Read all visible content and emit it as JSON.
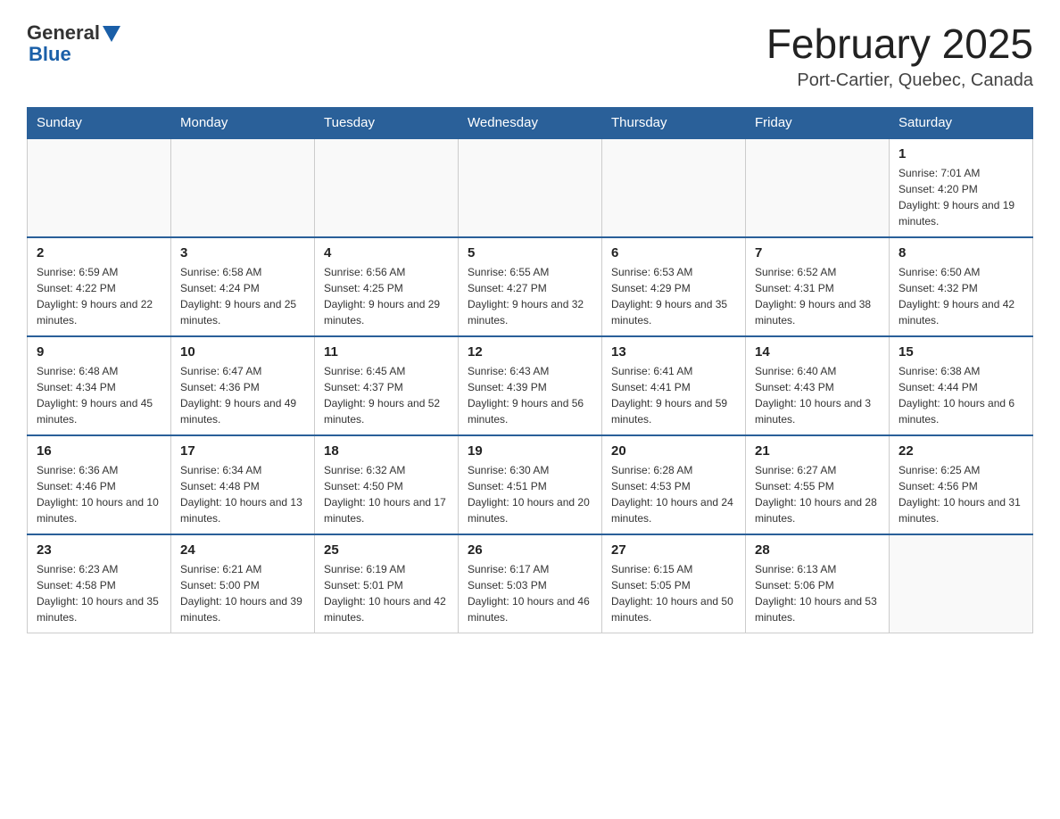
{
  "header": {
    "logo_general": "General",
    "logo_blue": "Blue",
    "month_year": "February 2025",
    "location": "Port-Cartier, Quebec, Canada"
  },
  "weekdays": [
    "Sunday",
    "Monday",
    "Tuesday",
    "Wednesday",
    "Thursday",
    "Friday",
    "Saturday"
  ],
  "weeks": [
    [
      {
        "day": "",
        "info": ""
      },
      {
        "day": "",
        "info": ""
      },
      {
        "day": "",
        "info": ""
      },
      {
        "day": "",
        "info": ""
      },
      {
        "day": "",
        "info": ""
      },
      {
        "day": "",
        "info": ""
      },
      {
        "day": "1",
        "info": "Sunrise: 7:01 AM\nSunset: 4:20 PM\nDaylight: 9 hours and 19 minutes."
      }
    ],
    [
      {
        "day": "2",
        "info": "Sunrise: 6:59 AM\nSunset: 4:22 PM\nDaylight: 9 hours and 22 minutes."
      },
      {
        "day": "3",
        "info": "Sunrise: 6:58 AM\nSunset: 4:24 PM\nDaylight: 9 hours and 25 minutes."
      },
      {
        "day": "4",
        "info": "Sunrise: 6:56 AM\nSunset: 4:25 PM\nDaylight: 9 hours and 29 minutes."
      },
      {
        "day": "5",
        "info": "Sunrise: 6:55 AM\nSunset: 4:27 PM\nDaylight: 9 hours and 32 minutes."
      },
      {
        "day": "6",
        "info": "Sunrise: 6:53 AM\nSunset: 4:29 PM\nDaylight: 9 hours and 35 minutes."
      },
      {
        "day": "7",
        "info": "Sunrise: 6:52 AM\nSunset: 4:31 PM\nDaylight: 9 hours and 38 minutes."
      },
      {
        "day": "8",
        "info": "Sunrise: 6:50 AM\nSunset: 4:32 PM\nDaylight: 9 hours and 42 minutes."
      }
    ],
    [
      {
        "day": "9",
        "info": "Sunrise: 6:48 AM\nSunset: 4:34 PM\nDaylight: 9 hours and 45 minutes."
      },
      {
        "day": "10",
        "info": "Sunrise: 6:47 AM\nSunset: 4:36 PM\nDaylight: 9 hours and 49 minutes."
      },
      {
        "day": "11",
        "info": "Sunrise: 6:45 AM\nSunset: 4:37 PM\nDaylight: 9 hours and 52 minutes."
      },
      {
        "day": "12",
        "info": "Sunrise: 6:43 AM\nSunset: 4:39 PM\nDaylight: 9 hours and 56 minutes."
      },
      {
        "day": "13",
        "info": "Sunrise: 6:41 AM\nSunset: 4:41 PM\nDaylight: 9 hours and 59 minutes."
      },
      {
        "day": "14",
        "info": "Sunrise: 6:40 AM\nSunset: 4:43 PM\nDaylight: 10 hours and 3 minutes."
      },
      {
        "day": "15",
        "info": "Sunrise: 6:38 AM\nSunset: 4:44 PM\nDaylight: 10 hours and 6 minutes."
      }
    ],
    [
      {
        "day": "16",
        "info": "Sunrise: 6:36 AM\nSunset: 4:46 PM\nDaylight: 10 hours and 10 minutes."
      },
      {
        "day": "17",
        "info": "Sunrise: 6:34 AM\nSunset: 4:48 PM\nDaylight: 10 hours and 13 minutes."
      },
      {
        "day": "18",
        "info": "Sunrise: 6:32 AM\nSunset: 4:50 PM\nDaylight: 10 hours and 17 minutes."
      },
      {
        "day": "19",
        "info": "Sunrise: 6:30 AM\nSunset: 4:51 PM\nDaylight: 10 hours and 20 minutes."
      },
      {
        "day": "20",
        "info": "Sunrise: 6:28 AM\nSunset: 4:53 PM\nDaylight: 10 hours and 24 minutes."
      },
      {
        "day": "21",
        "info": "Sunrise: 6:27 AM\nSunset: 4:55 PM\nDaylight: 10 hours and 28 minutes."
      },
      {
        "day": "22",
        "info": "Sunrise: 6:25 AM\nSunset: 4:56 PM\nDaylight: 10 hours and 31 minutes."
      }
    ],
    [
      {
        "day": "23",
        "info": "Sunrise: 6:23 AM\nSunset: 4:58 PM\nDaylight: 10 hours and 35 minutes."
      },
      {
        "day": "24",
        "info": "Sunrise: 6:21 AM\nSunset: 5:00 PM\nDaylight: 10 hours and 39 minutes."
      },
      {
        "day": "25",
        "info": "Sunrise: 6:19 AM\nSunset: 5:01 PM\nDaylight: 10 hours and 42 minutes."
      },
      {
        "day": "26",
        "info": "Sunrise: 6:17 AM\nSunset: 5:03 PM\nDaylight: 10 hours and 46 minutes."
      },
      {
        "day": "27",
        "info": "Sunrise: 6:15 AM\nSunset: 5:05 PM\nDaylight: 10 hours and 50 minutes."
      },
      {
        "day": "28",
        "info": "Sunrise: 6:13 AM\nSunset: 5:06 PM\nDaylight: 10 hours and 53 minutes."
      },
      {
        "day": "",
        "info": ""
      }
    ]
  ]
}
